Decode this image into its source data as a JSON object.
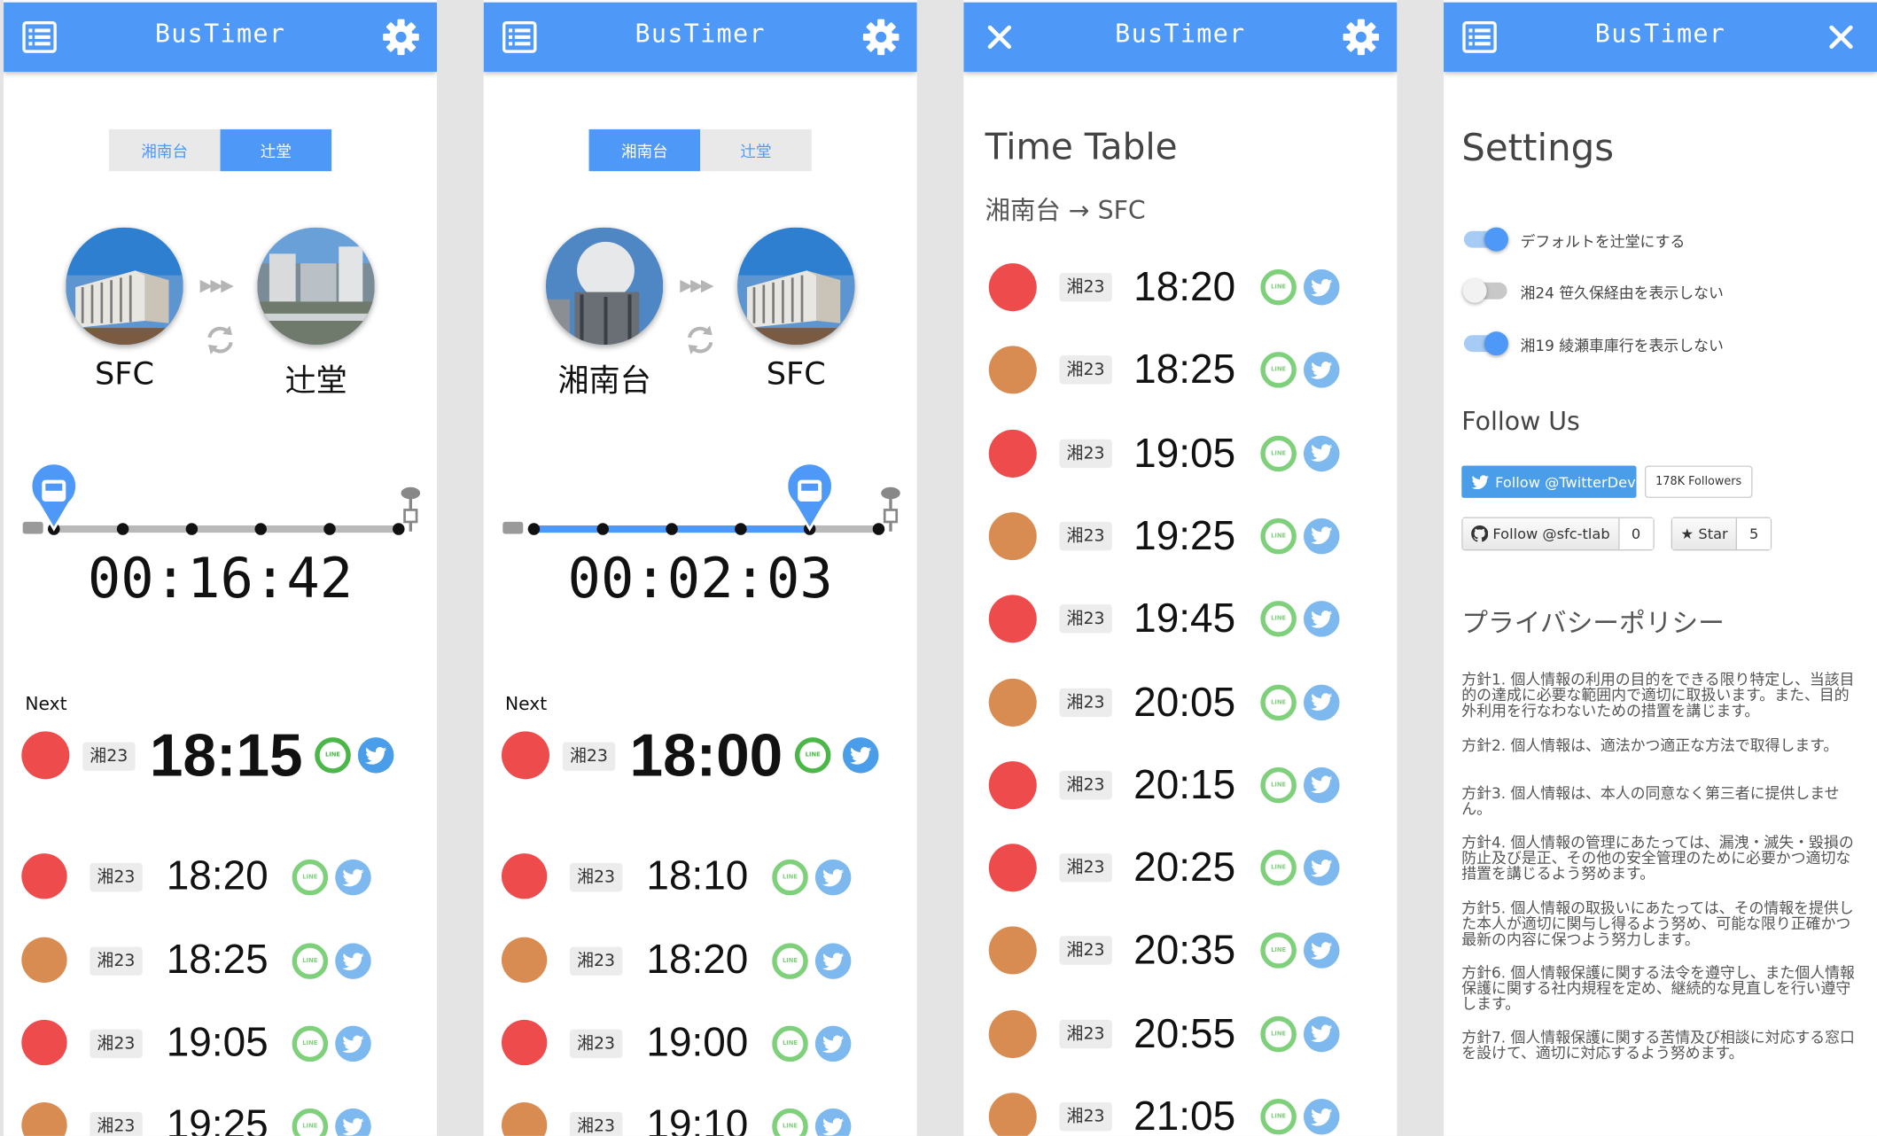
{
  "app": {
    "title": "BusTimer"
  },
  "colors": {
    "header": "#4e98f7",
    "red_line": "#ee4b4d",
    "orange_line": "#d98c52",
    "line_green": "#4bb748",
    "twitter_blue": "#4a9de9"
  },
  "panel1": {
    "tabs": [
      {
        "label": "湘南台",
        "active": false
      },
      {
        "label": "辻堂",
        "active": true
      }
    ],
    "from": "SFC",
    "to": "辻堂",
    "progress_fraction": 0.0,
    "countdown": "00:16:42",
    "next_label": "Next",
    "next": {
      "route": "湘23",
      "time": "18:15",
      "color": "red"
    },
    "upcoming": [
      {
        "route": "湘23",
        "time": "18:20",
        "color": "red"
      },
      {
        "route": "湘23",
        "time": "18:25",
        "color": "orange"
      },
      {
        "route": "湘23",
        "time": "19:05",
        "color": "red"
      },
      {
        "route": "湘23",
        "time": "19:25",
        "color": "orange"
      }
    ]
  },
  "panel2": {
    "tabs": [
      {
        "label": "湘南台",
        "active": true
      },
      {
        "label": "辻堂",
        "active": false
      }
    ],
    "from": "湘南台",
    "to": "SFC",
    "progress_fraction": 0.8,
    "countdown": "00:02:03",
    "next_label": "Next",
    "next": {
      "route": "湘23",
      "time": "18:00",
      "color": "red"
    },
    "upcoming": [
      {
        "route": "湘23",
        "time": "18:10",
        "color": "red"
      },
      {
        "route": "湘23",
        "time": "18:20",
        "color": "orange"
      },
      {
        "route": "湘23",
        "time": "19:00",
        "color": "red"
      },
      {
        "route": "湘23",
        "time": "19:10",
        "color": "orange"
      }
    ]
  },
  "timetable": {
    "title": "Time Table",
    "route_label": "湘南台 → SFC",
    "rows": [
      {
        "route": "湘23",
        "time": "18:20",
        "color": "red"
      },
      {
        "route": "湘23",
        "time": "18:25",
        "color": "orange"
      },
      {
        "route": "湘23",
        "time": "19:05",
        "color": "red"
      },
      {
        "route": "湘23",
        "time": "19:25",
        "color": "orange"
      },
      {
        "route": "湘23",
        "time": "19:45",
        "color": "red"
      },
      {
        "route": "湘23",
        "time": "20:05",
        "color": "orange"
      },
      {
        "route": "湘23",
        "time": "20:15",
        "color": "red"
      },
      {
        "route": "湘23",
        "time": "20:25",
        "color": "red"
      },
      {
        "route": "湘23",
        "time": "20:35",
        "color": "orange"
      },
      {
        "route": "湘23",
        "time": "20:55",
        "color": "orange"
      },
      {
        "route": "湘23",
        "time": "21:05",
        "color": "orange"
      }
    ]
  },
  "settings": {
    "title": "Settings",
    "toggles": [
      {
        "label": "デフォルトを辻堂にする",
        "on": true
      },
      {
        "label": "湘24 笹久保経由を表示しない",
        "on": false
      },
      {
        "label": "湘19 綾瀬車庫行を表示しない",
        "on": true
      }
    ],
    "follow_title": "Follow Us",
    "twitter_button": "Follow @TwitterDev",
    "twitter_followers": "178K Followers",
    "github_follow": "Follow @sfc-tlab",
    "github_follow_count": "0",
    "github_star": "Star",
    "github_star_count": "5",
    "privacy_title": "プライバシーポリシー",
    "policies": [
      "方針1. 個人情報の利用の目的をできる限り特定し、当該目的の達成に必要な範囲内で適切に取扱います。また、目的外利用を行なわないための措置を講じます。",
      "方針2. 個人情報は、適法かつ適正な方法で取得します。",
      "方針3. 個人情報は、本人の同意なく第三者に提供しません。",
      "方針4. 個人情報の管理にあたっては、漏洩・滅失・毀損の防止及び是正、その他の安全管理のために必要かつ適切な措置を講じるよう努めます。",
      "方針5. 個人情報の取扱いにあたっては、その情報を提供した本人が適切に関与し得るよう努め、可能な限り正確かつ最新の内容に保つよう努力します。",
      "方針6. 個人情報保護に関する法令を遵守し、また個人情報保護に関する社内規程を定め、継続的な見直しを行い遵守します。",
      "方針7. 個人情報保護に関する苦情及び相談に対応する窓口を設けて、適切に対応するよう努めます。"
    ]
  }
}
